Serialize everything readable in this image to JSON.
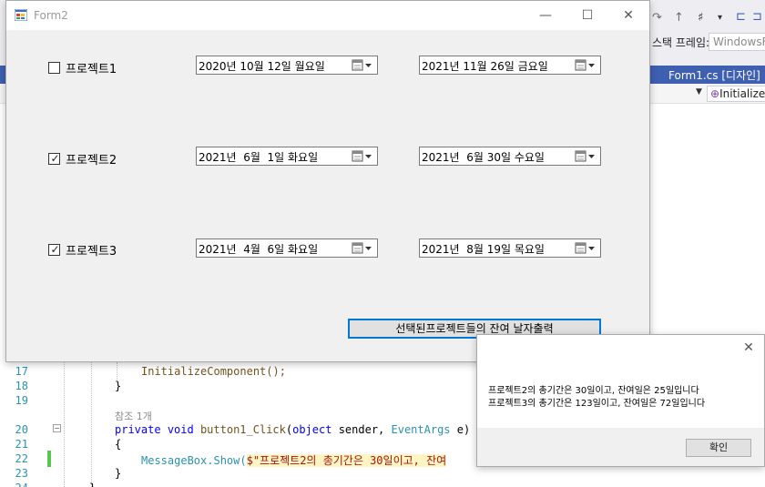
{
  "ide": {
    "frame_label": "스택 프레임:",
    "frame_combo": "WindowsFo",
    "active_tab": "Form1.cs [디자인]",
    "nav_combo": "Initialize",
    "lines": [
      {
        "num": "17",
        "text": "InitializeComponent();"
      },
      {
        "num": "18",
        "text": "}"
      },
      {
        "num": "19",
        "text": ""
      },
      {
        "num": "",
        "text": "참조 1개"
      },
      {
        "num": "20",
        "kw1": "private",
        "kw2": "void",
        "method": "button1_Click",
        "open": "(",
        "kw3": "object",
        "p1": " sender, ",
        "type": "EventArgs",
        "p2": " e)"
      },
      {
        "num": "21",
        "text": "{"
      },
      {
        "num": "22",
        "text": "MessageBox.Show(",
        "string": "$\"프로젝트2의 총기간은 30일이고, 잔여"
      },
      {
        "num": "23",
        "text": "}"
      },
      {
        "num": "24",
        "text": "}"
      }
    ]
  },
  "form2": {
    "title": "Form2",
    "controls": {
      "minimize_icon": "minimize-icon",
      "maximize_icon": "maximize-icon",
      "close_icon": "close-icon"
    },
    "projects": [
      {
        "label": "프로젝트1",
        "checked": false,
        "start_date": "2020년 10월 12일 월요일",
        "end_date": "2021년 11월 26일 금요일"
      },
      {
        "label": "프로젝트2",
        "checked": true,
        "start_date": "2021년  6월  1일 화요일",
        "end_date": "2021년  6월 30일 수요일"
      },
      {
        "label": "프로젝트3",
        "checked": true,
        "start_date": "2021년  4월  6일 화요일",
        "end_date": "2021년  8월 19일 목요일"
      }
    ],
    "button_label": "선택된프로젝트들의 잔여 날자출력"
  },
  "msgbox": {
    "lines": [
      "프로젝트2의 총기간은 30일이고, 잔여일은 25일입니다",
      "프로젝트3의 총기간은 123일이고, 잔여일은 72일입니다"
    ],
    "ok_label": "확인"
  },
  "colors": {
    "accent": "#0078d7",
    "ide_tab_bar": "#3f5fb1"
  }
}
